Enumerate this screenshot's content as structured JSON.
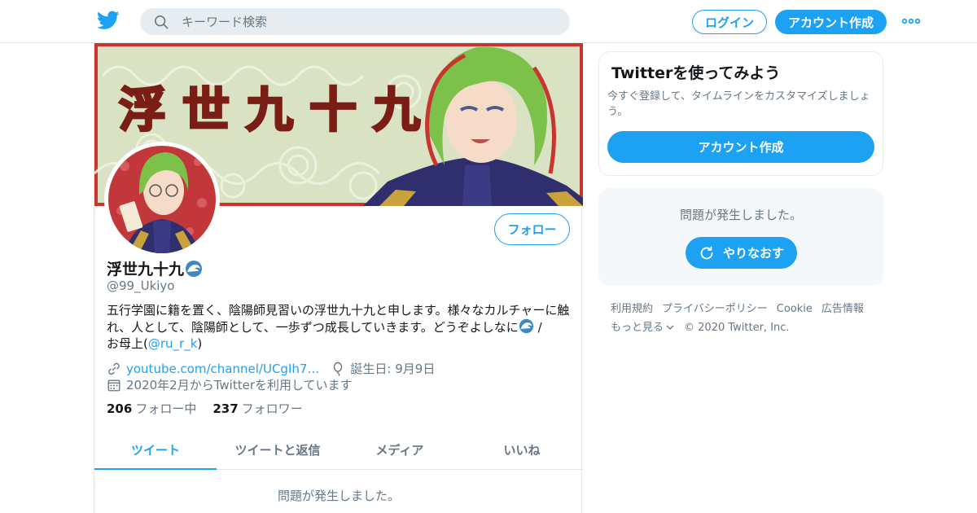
{
  "topbar": {
    "search_placeholder": "キーワード検索",
    "login_label": "ログイン",
    "signup_label": "アカウント作成",
    "brand_color": "#1da1f2"
  },
  "banner": {
    "title_text": "浮世九十九"
  },
  "profile": {
    "follow_label": "フォロー",
    "name": "浮世九十九",
    "handle": "@99_Ukiyo",
    "bio_part1": "五行学園に籍を置く、陰陽師見習いの浮世九十九と申します。様々なカルチャーに触れ、人として、陰陽師として、一歩ずつ成長していきます。どうぞよしなに",
    "bio_part2": " /",
    "bio_part3": "お母上(",
    "bio_mention": "@ru_r_k",
    "bio_part4": ")",
    "url": "youtube.com/channel/UCgIh7…",
    "birthday": "誕生日: 9月9日",
    "joined": "2020年2月からTwitterを利用しています",
    "following_count": "206",
    "following_label": "フォロー中",
    "followers_count": "237",
    "followers_label": "フォロワー"
  },
  "tabs": [
    {
      "label": "ツイート",
      "active": true
    },
    {
      "label": "ツイートと返信",
      "active": false
    },
    {
      "label": "メディア",
      "active": false
    },
    {
      "label": "いいね",
      "active": false
    }
  ],
  "timeline": {
    "error_message": "問題が発生しました。"
  },
  "signup_card": {
    "title": "Twitterを使ってみよう",
    "description": "今すぐ登録して、タイムラインをカスタマイズしましょう。",
    "button_label": "アカウント作成"
  },
  "error_card": {
    "message": "問題が発生しました。",
    "retry_label": "やりなおす"
  },
  "footer": {
    "terms": "利用規約",
    "privacy": "プライバシーポリシー",
    "cookie": "Cookie",
    "ads": "広告情報",
    "more": "もっと見る",
    "copyright": "© 2020 Twitter, Inc."
  }
}
